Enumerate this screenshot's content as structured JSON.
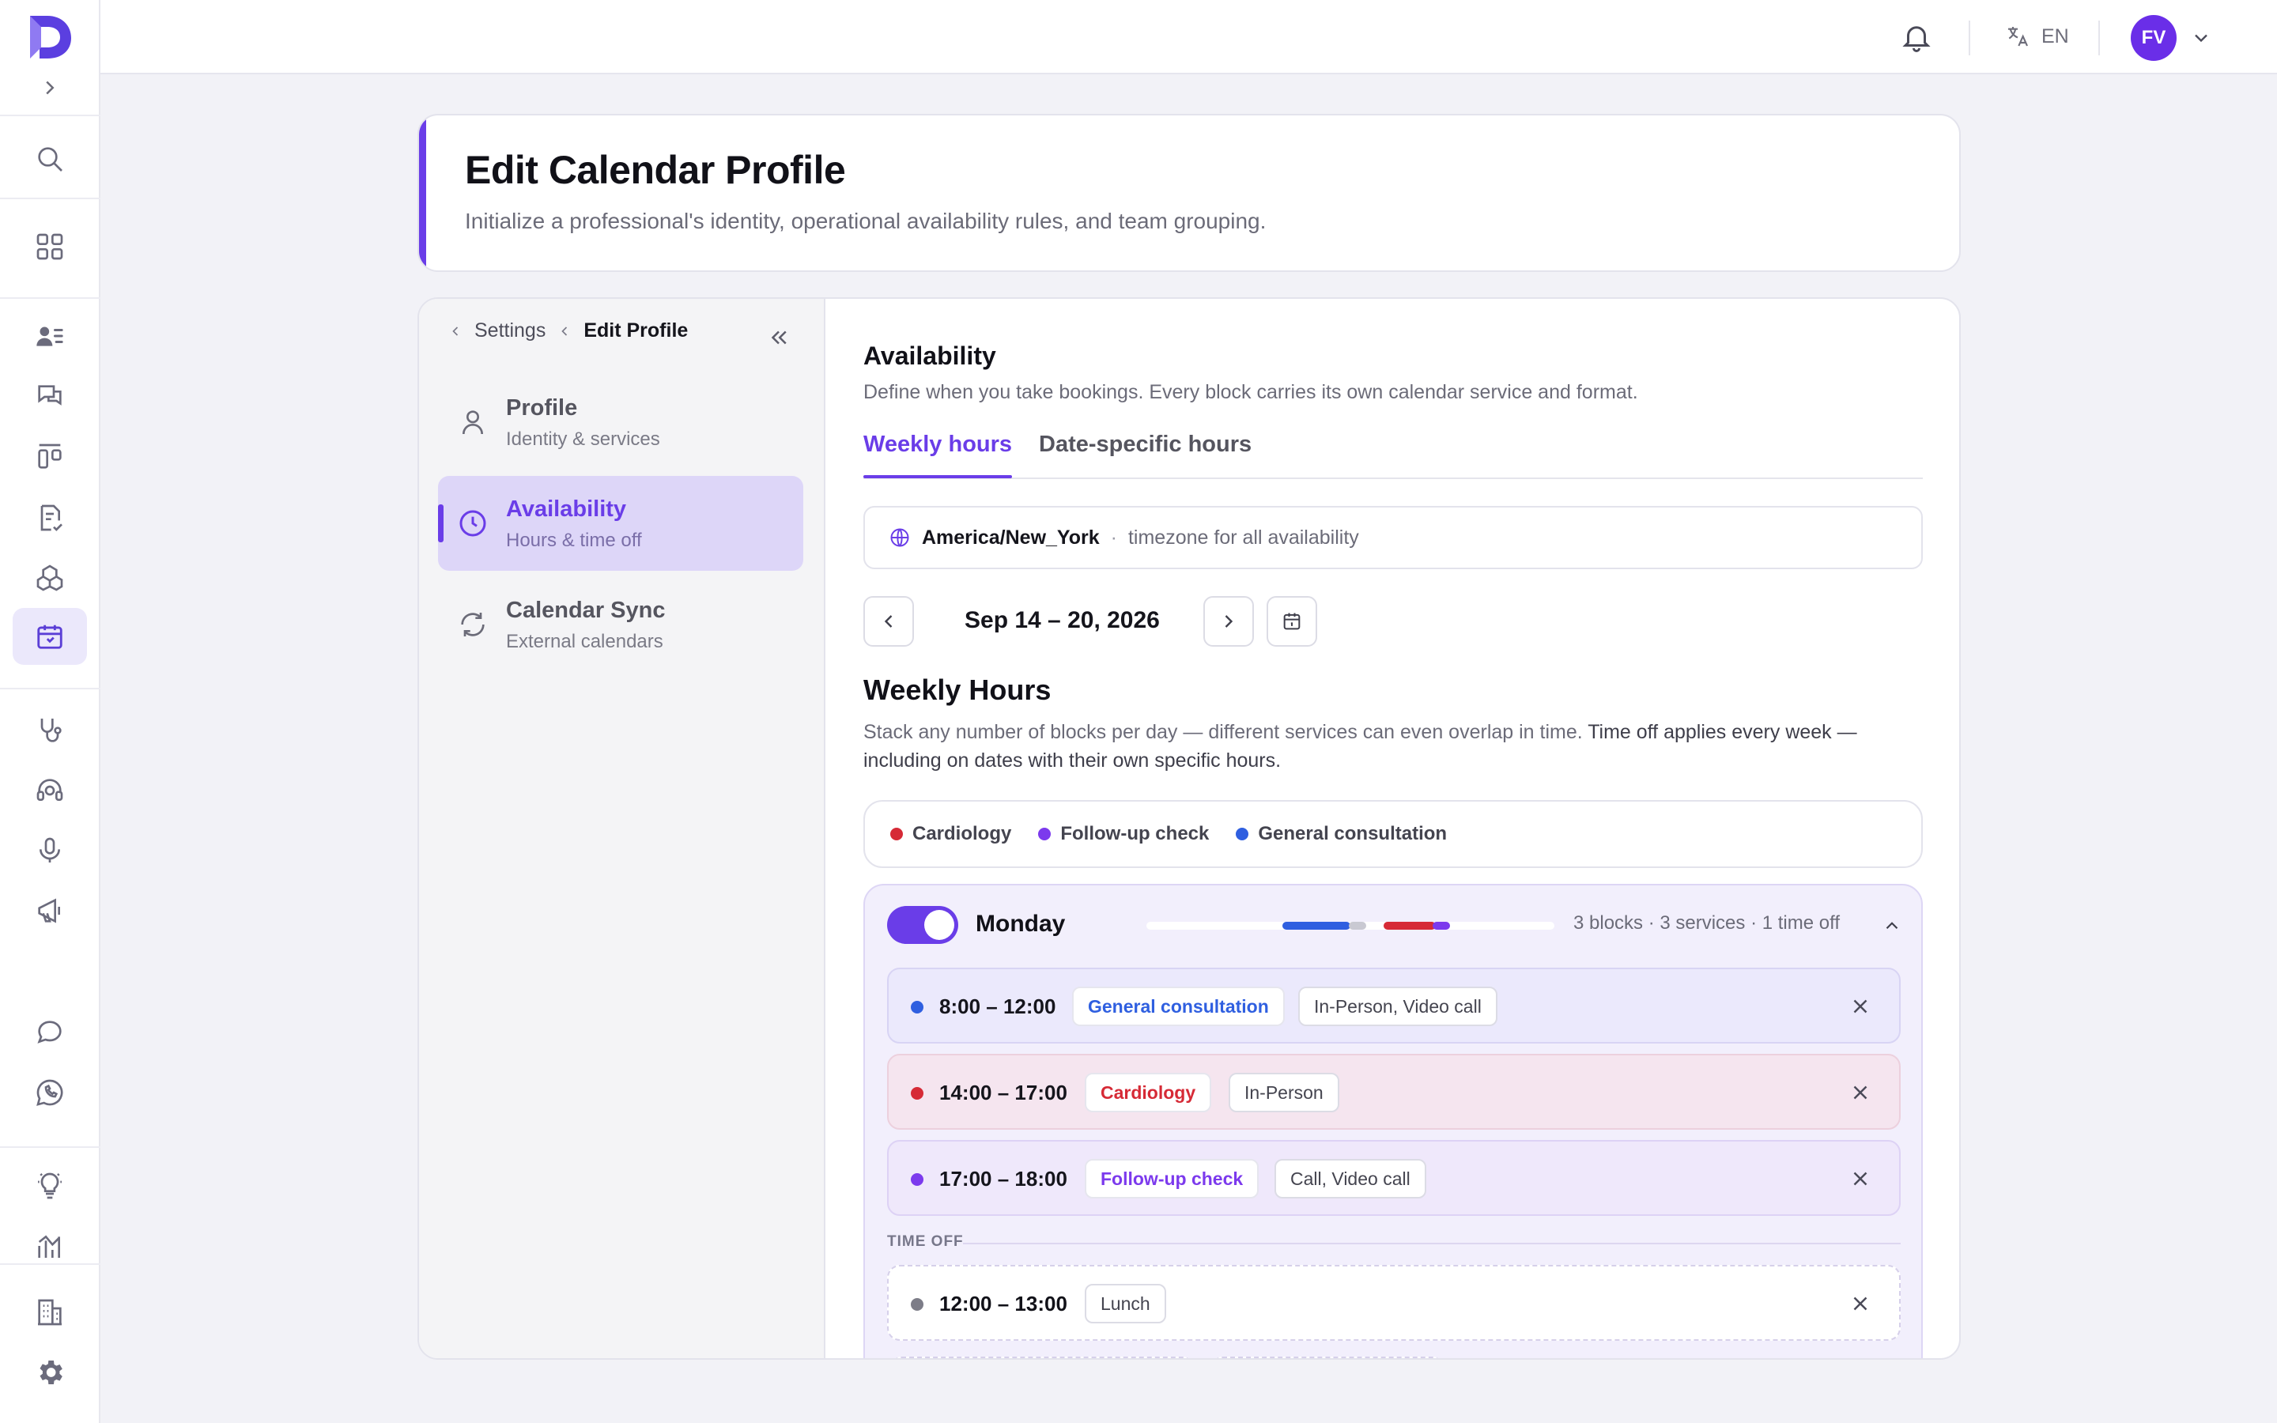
{
  "topbar": {
    "language": "EN",
    "avatar_initials": "FV"
  },
  "header": {
    "title": "Edit Calendar Profile",
    "subtitle": "Initialize a professional's identity, operational availability rules, and team grouping."
  },
  "breadcrumb": {
    "parent": "Settings",
    "current": "Edit Profile"
  },
  "nav": [
    {
      "title": "Profile",
      "subtitle": "Identity & services",
      "icon": "user-icon"
    },
    {
      "title": "Availability",
      "subtitle": "Hours & time off",
      "icon": "clock-icon",
      "active": true
    },
    {
      "title": "Calendar Sync",
      "subtitle": "External calendars",
      "icon": "refresh-icon"
    }
  ],
  "availability": {
    "title": "Availability",
    "description": "Define when you take bookings. Every block carries its own calendar service and format.",
    "tabs": [
      "Weekly hours",
      "Date-specific hours"
    ],
    "timezone": "America/New_York",
    "timezone_separator": "·",
    "timezone_note": "timezone for all availability",
    "week_range": "Sep 14 – 20, 2026"
  },
  "weekly": {
    "title": "Weekly Hours",
    "description_a": "Stack any number of blocks per day — different services can even overlap in time. ",
    "description_b": "Time off applies every week — including on dates with their own specific hours."
  },
  "legend": [
    {
      "name": "Cardiology",
      "color": "#d62a36"
    },
    {
      "name": "Follow-up check",
      "color": "#7c3aed"
    },
    {
      "name": "General consultation",
      "color": "#2f5fe0"
    }
  ],
  "monday": {
    "name": "Monday",
    "enabled": true,
    "meta": "3 blocks · 3 services · 1 time off",
    "blocks": [
      {
        "time": "8:00 – 12:00",
        "service": "General consultation",
        "format": "In-Person, Video call",
        "color": "#2f5fe0"
      },
      {
        "time": "14:00 – 17:00",
        "service": "Cardiology",
        "format": "In-Person",
        "color": "#d62a36"
      },
      {
        "time": "17:00 – 18:00",
        "service": "Follow-up check",
        "format": "Call, Video call",
        "color": "#7c3aed"
      }
    ],
    "time_off_label": "TIME OFF",
    "time_off": [
      {
        "time": "12:00 – 13:00",
        "label": "Lunch"
      }
    ]
  },
  "colors": {
    "accent": "#6a3de8"
  }
}
